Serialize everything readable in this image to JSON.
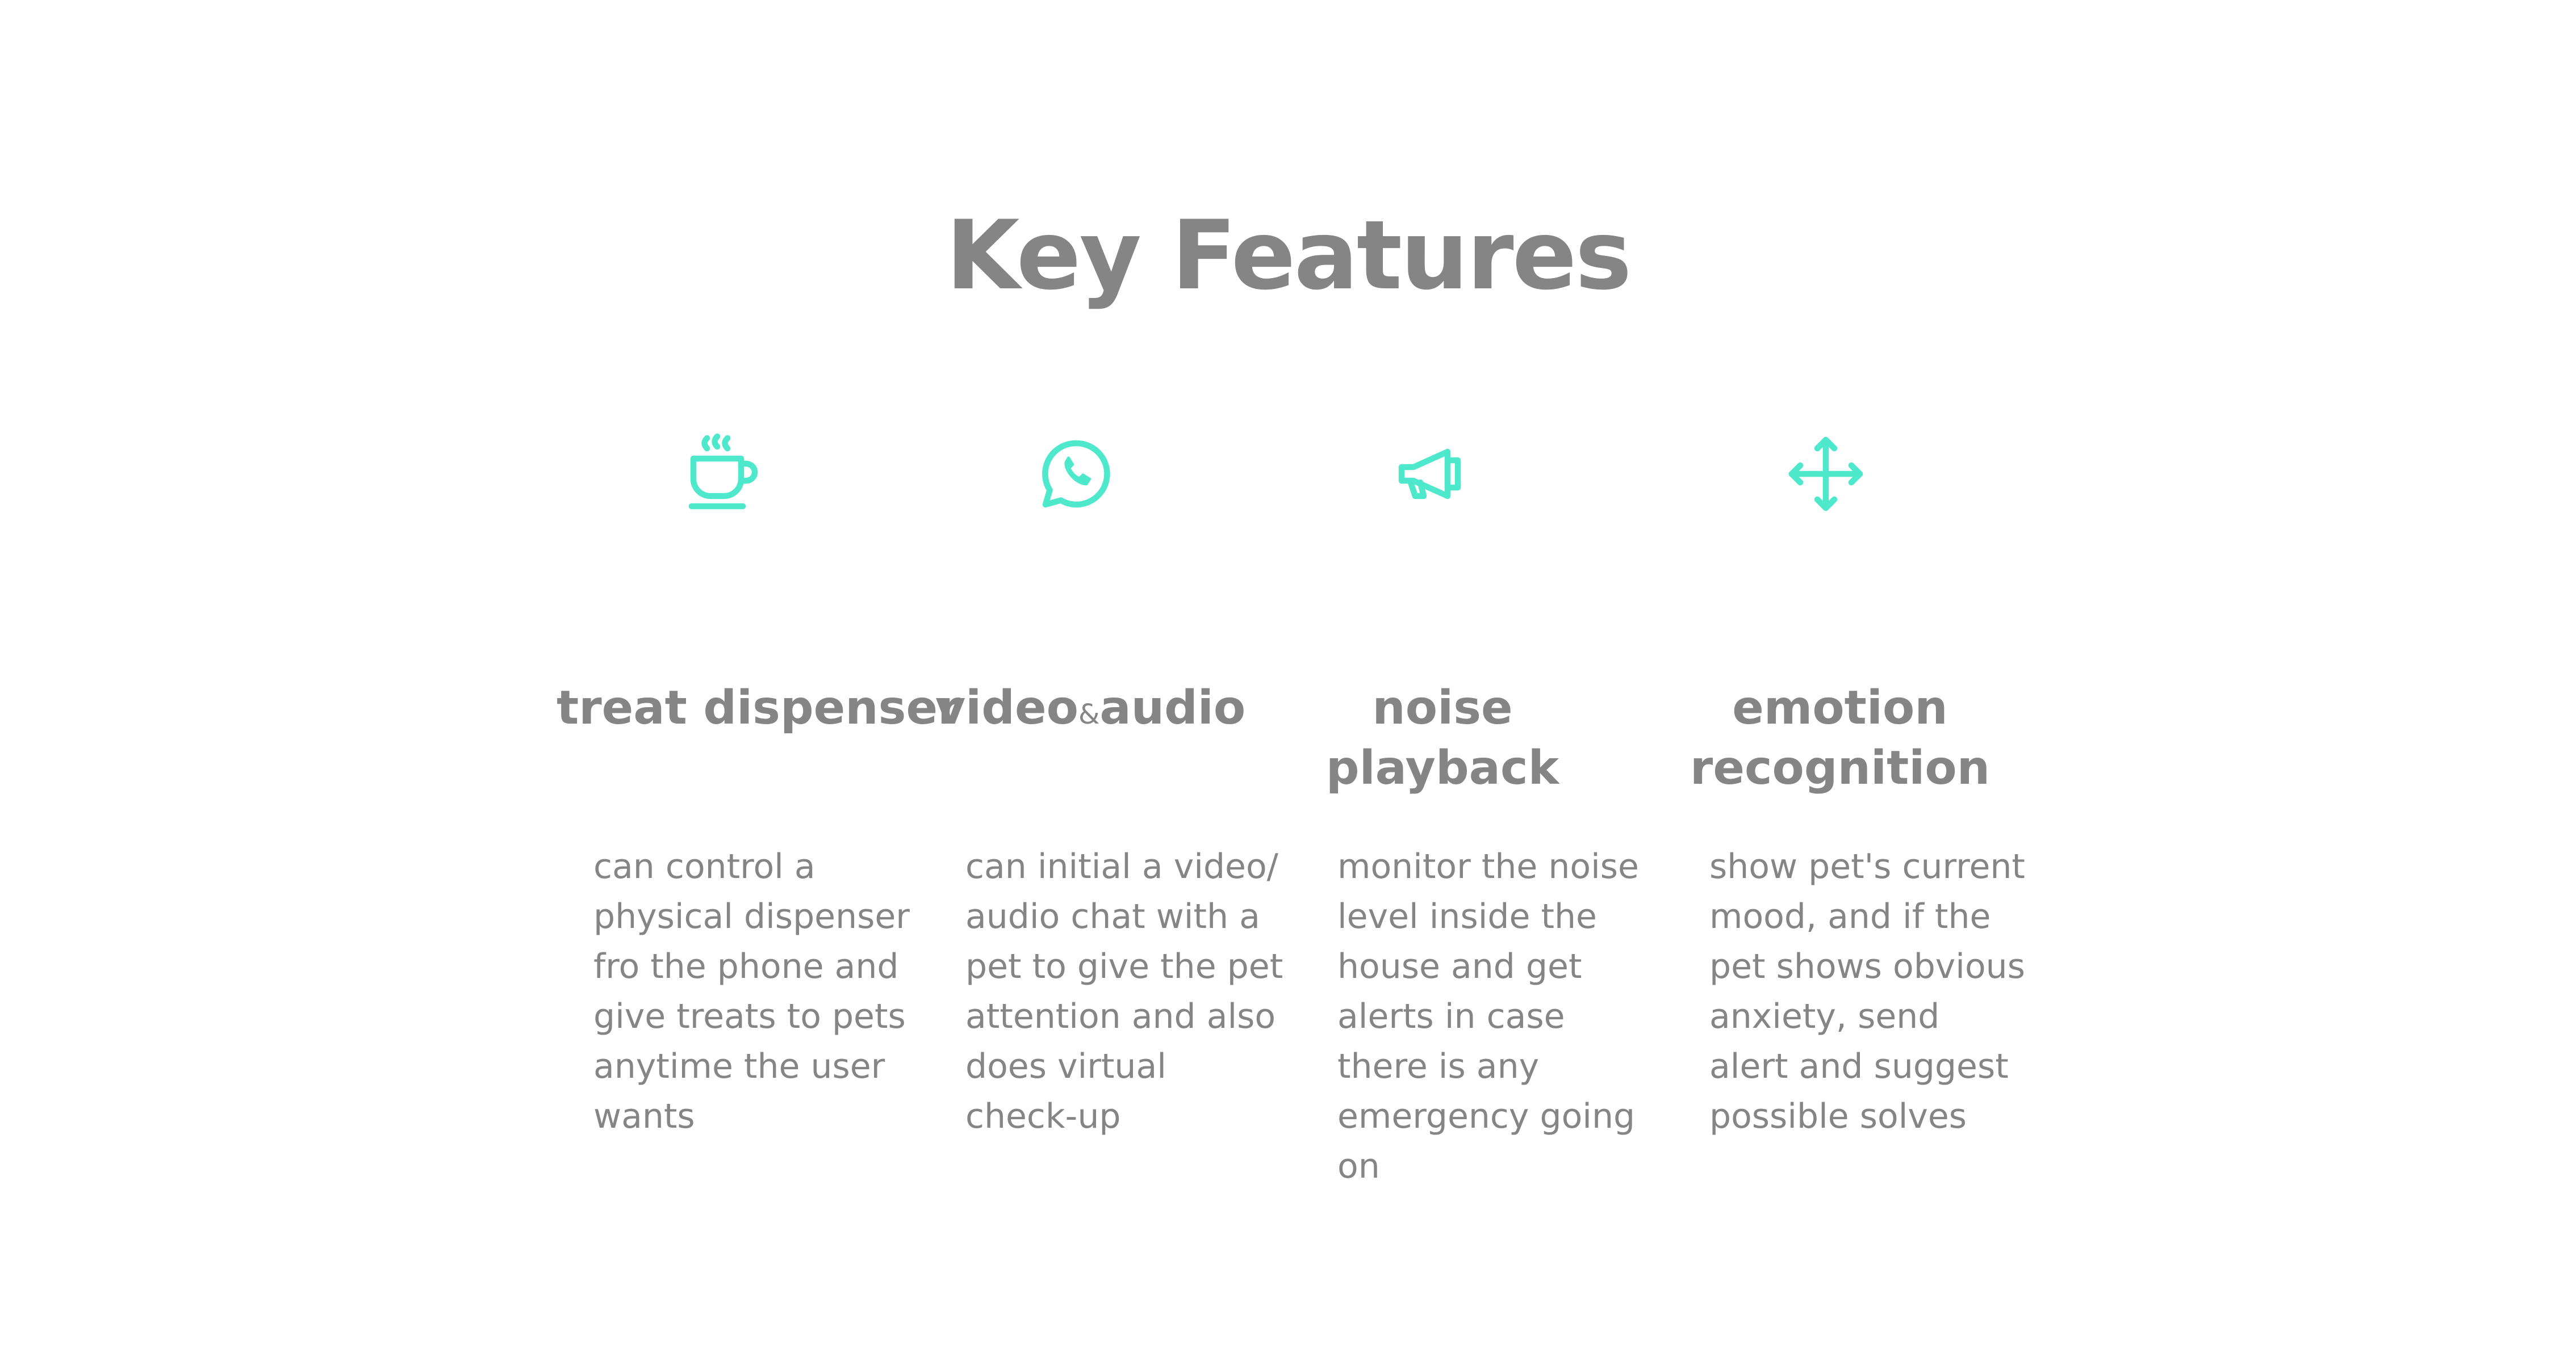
{
  "page": {
    "title": "Key Features",
    "accent_color": "#4ee8cd",
    "text_color": "#858585"
  },
  "features": [
    {
      "icon": "coffee-cup-icon",
      "title": "treat dispenser",
      "description": "can control a physical dispenser fro the phone and give treats to pets anytime the user wants"
    },
    {
      "icon": "whatsapp-phone-chat-icon",
      "title_part1": "video",
      "title_amp": "&",
      "title_part2": "audio",
      "description": "can initial a video/ audio chat with a pet to give the pet attention and also does virtual check-up"
    },
    {
      "icon": "megaphone-icon",
      "title_line1": "noise",
      "title_line2": "playback",
      "description": "monitor the noise level inside the house and get alerts in case there is any emergency going on"
    },
    {
      "icon": "move-arrows-icon",
      "title_line1": "emotion",
      "title_line2": "recognition",
      "description": "show pet's current mood, and if the pet shows obvious anxiety, send alert and suggest possible solves"
    }
  ]
}
